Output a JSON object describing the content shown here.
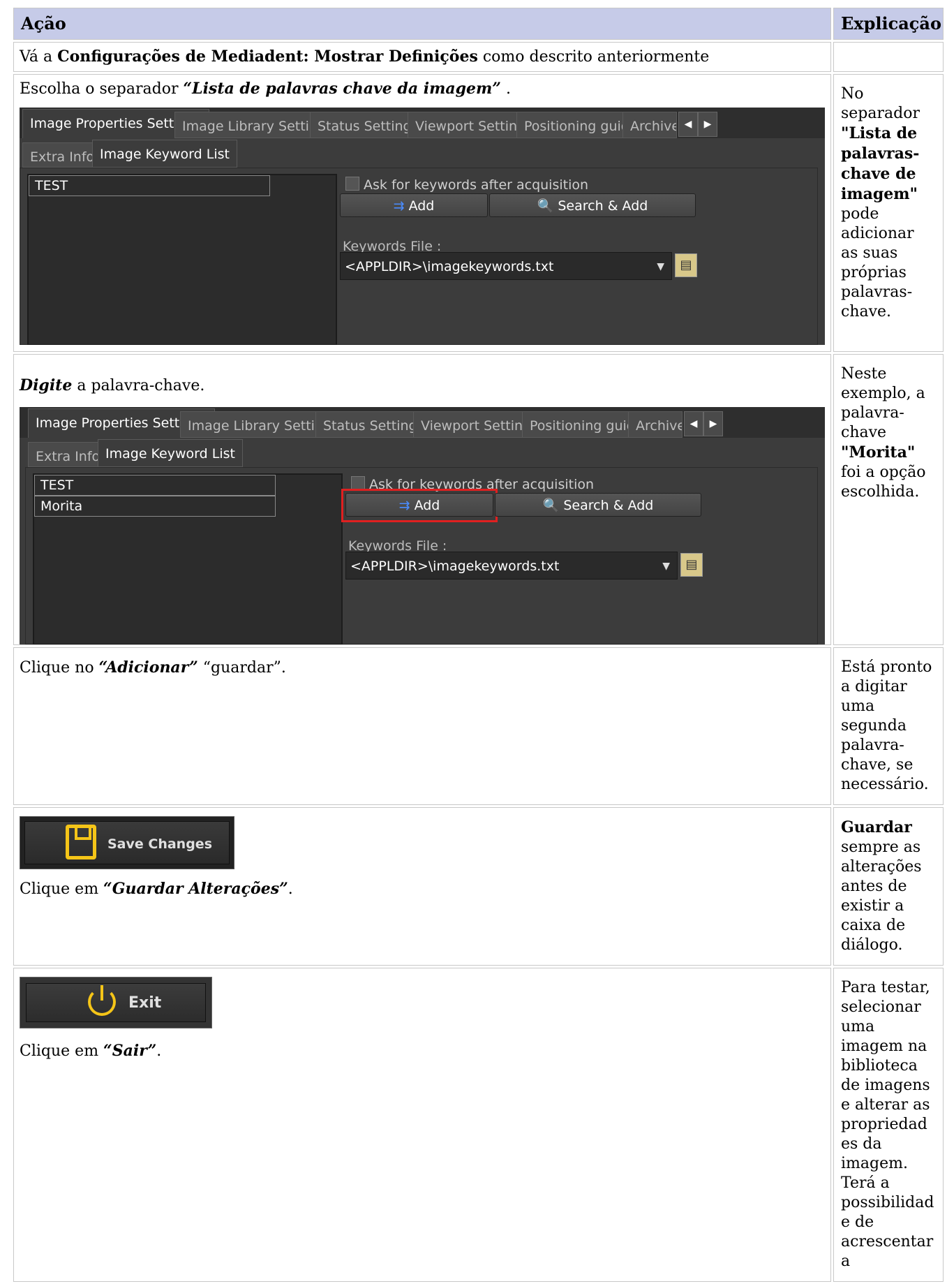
{
  "header": {
    "col1": "Ação",
    "col2": "Explicação"
  },
  "row1": {
    "pre": "Vá a ",
    "bold": "Configurações de Mediadent: Mostrar Definições",
    "post": " como descrito anteriormente",
    "expl": ""
  },
  "row2": {
    "pre": "Escolha o separador ",
    "bi": "“Lista de palavras chave da imagem”",
    "post": " .",
    "expl_pre": "No separador ",
    "expl_bold": "\"Lista de palavras-chave de imagem\"",
    "expl_post": " pode adicionar as suas próprias palavras-chave."
  },
  "row3": {
    "bi": "Digite",
    "post": " a palavra-chave.",
    "expl_pre": "Neste exemplo, a palavra-chave ",
    "expl_bold": "\"Morita\"",
    "expl_post": " foi a opção escolhida."
  },
  "row4": {
    "pre": "Clique no ",
    "bi": "“Adicionar”",
    "post": " “guardar”.",
    "expl": "Está pronto a digitar uma segunda palavra-chave, se necessário."
  },
  "row5": {
    "pre": "Clique em ",
    "bi": "“Guardar Alterações”",
    "post": ".",
    "expl_bold": "Guardar",
    "expl_post": " sempre as alterações antes de existir a caixa de diálogo.",
    "button": "Save Changes"
  },
  "row6": {
    "pre": "Clique em ",
    "bi": "“Sair”",
    "post": ".",
    "expl": "Para testar, selecionar uma imagem na biblioteca de imagens e alterar as propriedades da imagem. Terá a possibilidade de acrescentar a",
    "button": "Exit"
  },
  "app": {
    "tabs": [
      "Image Properties Settings",
      "Image Library Settings",
      "Status Settings",
      "Viewport Settings",
      "Positioning guide",
      "Archive"
    ],
    "subtabs": [
      "Extra Info",
      "Image Keyword List"
    ],
    "keywords1": [
      "TEST"
    ],
    "keywords2": [
      "TEST",
      "Morita"
    ],
    "ask_label": "Ask for keywords after acquisition",
    "add_label": "Add",
    "search_add_label": "Search & Add",
    "keywords_file_label": "Keywords File :",
    "keywords_file_value": "<APPLDIR>\\imagekeywords.txt"
  }
}
